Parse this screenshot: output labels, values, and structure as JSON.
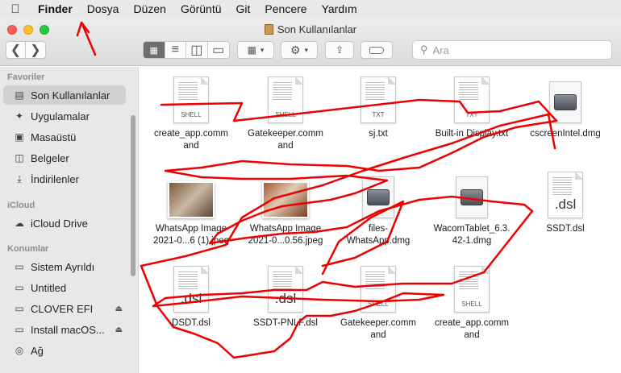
{
  "menubar": {
    "apple_icon": "apple-logo-icon",
    "items": [
      "Finder",
      "Dosya",
      "Düzen",
      "Görüntü",
      "Git",
      "Pencere",
      "Yardım"
    ]
  },
  "window": {
    "title": "Son Kullanılanlar"
  },
  "toolbar": {
    "search_placeholder": "Ara",
    "view_modes": [
      "icon-view-icon",
      "list-view-icon",
      "column-view-icon",
      "gallery-view-icon"
    ],
    "selected_view": "icon-view-icon"
  },
  "sidebar": {
    "sections": [
      "Favoriler",
      "iCloud",
      "Konumlar"
    ],
    "favorites": [
      {
        "label": "Son Kullanılanlar",
        "icon": "recents-icon"
      },
      {
        "label": "Uygulamalar",
        "icon": "applications-icon"
      },
      {
        "label": "Masaüstü",
        "icon": "desktop-icon"
      },
      {
        "label": "Belgeler",
        "icon": "documents-icon"
      },
      {
        "label": "İndirilenler",
        "icon": "downloads-icon"
      }
    ],
    "icloud": [
      {
        "label": "iCloud Drive",
        "icon": "icloud-icon"
      }
    ],
    "locations": [
      {
        "label": "Sistem Ayrıldı",
        "icon": "disk-icon"
      },
      {
        "label": "Untitled",
        "icon": "disk-icon"
      },
      {
        "label": "CLOVER EFI",
        "icon": "disk-icon"
      },
      {
        "label": "Install macOS...",
        "icon": "disk-icon"
      },
      {
        "label": "Ağ",
        "icon": "network-icon"
      }
    ]
  },
  "files": [
    {
      "name": "create_app.comm\nand",
      "tag": "SHELL"
    },
    {
      "name": "Gatekeeper.comm\nand",
      "tag": "SHELL"
    },
    {
      "name": "sj.txt",
      "tag": "TXT"
    },
    {
      "name": "Built-in Display.txt",
      "tag": "TXT"
    },
    {
      "name": "cscreenIntel.dmg",
      "tag": ""
    },
    {
      "name": "WhatsApp Image\n2021-0...6 (1).jpeg",
      "tag": ""
    },
    {
      "name": "WhatsApp Image\n2021-0...0.56.jpeg",
      "tag": ""
    },
    {
      "name": "files-\nWhatsApp.dmg",
      "tag": ""
    },
    {
      "name": "WacomTablet_6.3.\n42-1.dmg",
      "tag": ""
    },
    {
      "name": "SSDT.dsl",
      "tag": ".dsl"
    },
    {
      "name": "DSDT.dsl",
      "tag": ".dsl"
    },
    {
      "name": "SSDT-PNLF.dsl",
      "tag": ".dsl"
    },
    {
      "name": "Gatekeeper.comm\nand",
      "tag": "SHELL"
    },
    {
      "name": "create_app.comm\nand",
      "tag": "SHELL"
    }
  ],
  "colors": {
    "annotation_red": "#ee0000",
    "selected_sidebar": "#d0d0d0"
  }
}
